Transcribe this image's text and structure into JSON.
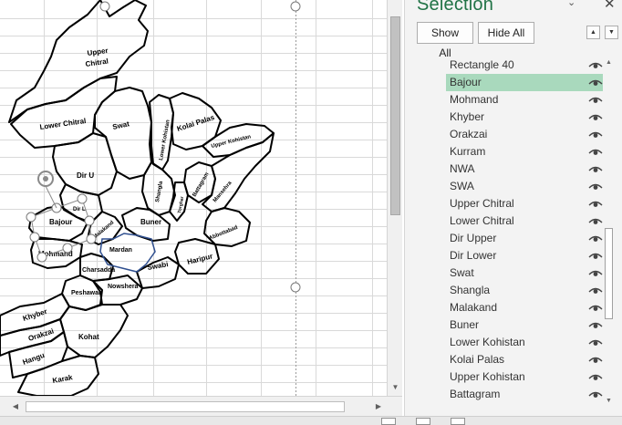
{
  "map": {
    "labels": {
      "upper_chitral": "Upper\nChitral",
      "lower_chitral": "Lower Chitral",
      "swat": "Swat",
      "kolai_palas": "Kolai Palas",
      "upper_kohistan": "Upper Kohistan",
      "lower_kohistan": "Lower Kohistan",
      "dir_u": "Dir U",
      "dir_l": "Dir L",
      "bajour": "Bajour",
      "mohmand": "Mohmand",
      "malakand": "Malakand",
      "shangla": "Shangla",
      "battagram": "Battagram",
      "mansehra": "Mansehra",
      "buner": "Buner",
      "torghar": "Torghar",
      "mardan": "Mardan",
      "abbottabad": "Abbottabad",
      "charsadda": "Charsadda",
      "swabi": "Swabi",
      "haripur": "Haripur",
      "peshawar": "Peshawar",
      "nowshera": "Nowshera",
      "khyber": "Khyber",
      "orakzai": "Orakzai",
      "kohat": "Kohat",
      "hangu": "Hangu",
      "karak": "Karak"
    }
  },
  "selection_pane": {
    "title": "Selection",
    "menu_icon": "dropdown-icon",
    "close_icon": "close-icon",
    "show_all_label": "Show All",
    "hide_all_label": "Hide All",
    "bring_forward_icon": "triangle-up-icon",
    "send_backward_icon": "triangle-down-icon",
    "selected_item": "Bajour",
    "items": [
      "Rectangle 40",
      "Bajour",
      "Mohmand",
      "Khyber",
      "Orakzai",
      "Kurram",
      "NWA",
      "SWA",
      "Upper Chitral",
      "Lower Chitral",
      "Dir Upper",
      "Dir Lower",
      "Swat",
      "Shangla",
      "Malakand",
      "Buner",
      "Lower Kohistan",
      "Kolai Palas",
      "Upper Kohistan",
      "Battagram"
    ]
  },
  "colors": {
    "accent": "#217346",
    "selected_row": "#a9d9bd",
    "map_stroke": "#000000",
    "selected_shape_outline": "#2f4f8f"
  }
}
